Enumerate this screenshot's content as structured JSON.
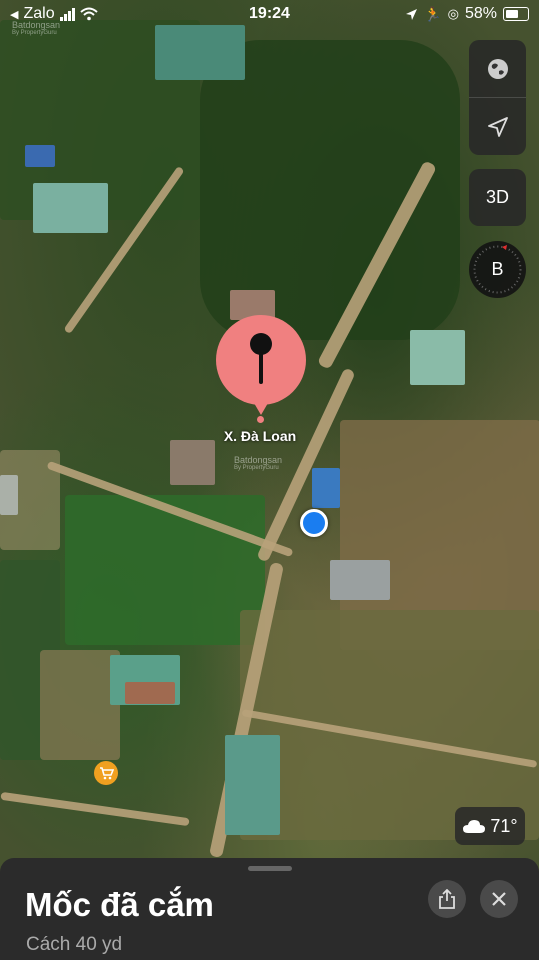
{
  "status_bar": {
    "back_app": "Zalo",
    "time": "19:24",
    "battery": "58%"
  },
  "map": {
    "pin_label": "X. Đà Loan",
    "watermark": "Batdongsan",
    "watermark_sub": "By PropertyGuru"
  },
  "controls": {
    "three_d": "3D",
    "compass": "B"
  },
  "weather": {
    "temperature": "71°"
  },
  "sheet": {
    "title": "Mốc đã cắm",
    "subtitle": "Cách 40 yd"
  },
  "icons": {
    "globe": "globe-icon",
    "location": "location-arrow-icon",
    "share": "share-icon",
    "close": "close-icon",
    "cart": "shopping-cart-icon",
    "cloud": "cloud-icon"
  },
  "colors": {
    "pin": "#f08080",
    "user_location": "#1a7df0",
    "poi": "#f0a020",
    "sheet_bg": "#2b2b2b"
  }
}
